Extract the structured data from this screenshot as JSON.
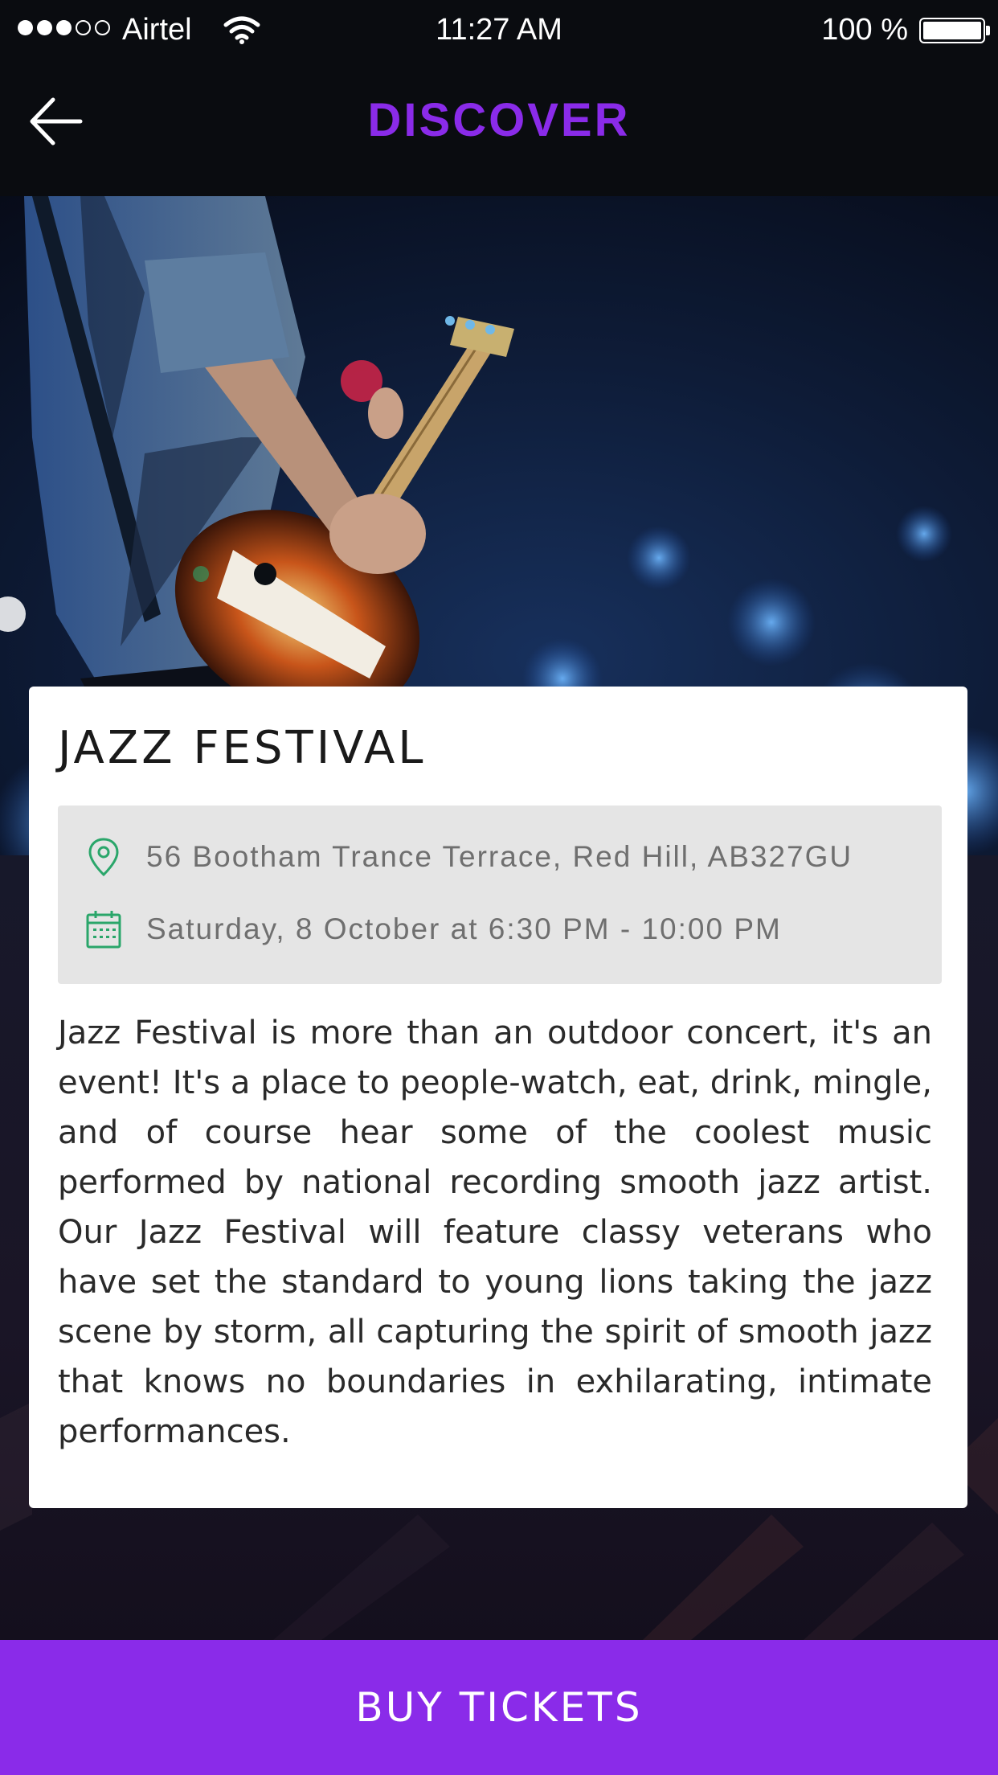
{
  "status_bar": {
    "carrier": "Airtel",
    "time": "11:27 AM",
    "battery": "100 %",
    "signal_strength": 3,
    "signal_max": 5
  },
  "header": {
    "title": "DISCOVER",
    "back_icon": "back-arrow-icon"
  },
  "event": {
    "title": "JAZZ FESTIVAL",
    "location": "56 Bootham Trance  Terrace, Red Hill, AB327GU",
    "location_icon": "map-pin-icon",
    "datetime": "Saturday, 8 October at 6:30 PM - 10:00 PM",
    "datetime_icon": "calendar-icon",
    "description": "Jazz Festival is more than an outdoor concert, it's an event! It's a place to people-watch, eat, drink, mingle, and of course hear some of the coolest music performed by national recording smooth jazz artist. Our Jazz Festival will feature classy veterans who have set the standard to young lions taking the jazz scene by storm, all capturing the spirit of smooth jazz that knows no boundaries in exhilarating, intimate performances."
  },
  "footer": {
    "buy_label": "BUY TICKETS"
  },
  "colors": {
    "accent": "#8a2be9",
    "icon_green": "#2aa66a",
    "bar_bg": "#0a0c10"
  }
}
